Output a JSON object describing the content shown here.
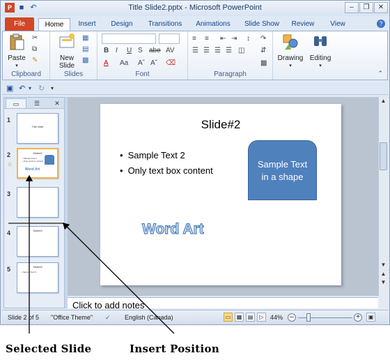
{
  "window": {
    "title": "Title Slide2.pptx - Microsoft PowerPoint"
  },
  "tabs": {
    "file": "File",
    "items": [
      "Home",
      "Insert",
      "Design",
      "Transitions",
      "Animations",
      "Slide Show",
      "Review",
      "View"
    ],
    "active": "Home"
  },
  "ribbon": {
    "clipboard": {
      "label": "Clipboard",
      "paste": "Paste"
    },
    "slides": {
      "label": "Slides",
      "new_slide_line1": "New",
      "new_slide_line2": "Slide"
    },
    "font": {
      "label": "Font",
      "bold": "B",
      "italic": "I",
      "underline": "U",
      "strike": "S",
      "shadow": "abe",
      "font_color": "A",
      "case": "Aa"
    },
    "paragraph": {
      "label": "Paragraph"
    },
    "drawing": {
      "label": "Drawing"
    },
    "editing": {
      "label": "Editing"
    }
  },
  "slide_pane": {
    "thumbnails": [
      {
        "num": "1",
        "title": "Title slide"
      },
      {
        "num": "2",
        "title": "Slide#2",
        "line1": "• Sample Text 2",
        "line2": "• Only text box content",
        "shape": "Sample Text",
        "wordart": "Word Art",
        "selected": true
      },
      {
        "num": "3"
      },
      {
        "num": "4",
        "title": "Slide#4"
      },
      {
        "num": "5",
        "title": "Slide#5",
        "line1": "• Sample Text 5"
      }
    ]
  },
  "slide": {
    "title": "Slide#2",
    "bullets": [
      "Sample Text 2",
      "Only text box content"
    ],
    "shape_line1": "Sample Text",
    "shape_line2": "in a shape",
    "wordart": "Word Art"
  },
  "notes": {
    "placeholder": "Click to add notes"
  },
  "status": {
    "slide_of": "Slide 2 of 5",
    "theme": "\"Office Theme\"",
    "language": "English (Canada)",
    "zoom": "44%"
  },
  "annotations": {
    "selected_slide": "Selected Slide",
    "insert_position": "Insert Position"
  },
  "colors": {
    "file_tab": "#d24726",
    "shape_fill": "#4f81bd",
    "selection": "#f2b24a"
  }
}
